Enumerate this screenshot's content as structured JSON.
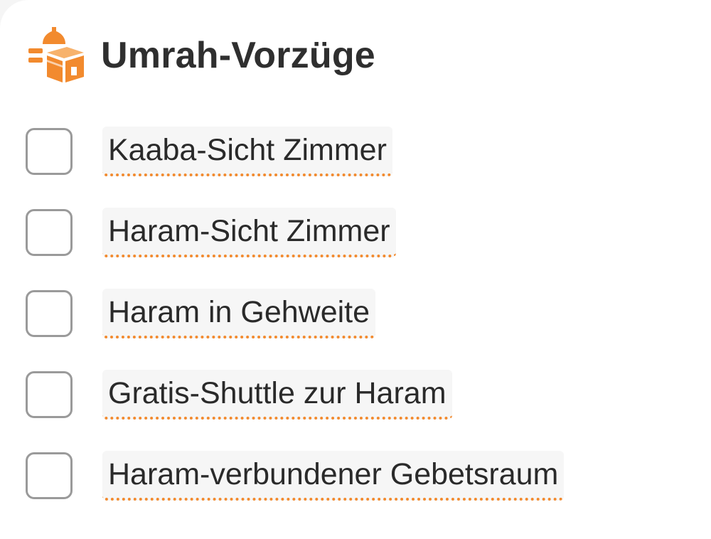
{
  "section": {
    "title": "Umrah-Vorzüge",
    "icon": "kaaba-icon",
    "accent_color": "#f28a2e"
  },
  "options": [
    {
      "label": "Kaaba-Sicht Zimmer",
      "checked": false
    },
    {
      "label": "Haram-Sicht Zimmer",
      "checked": false
    },
    {
      "label": "Haram in Gehweite",
      "checked": false
    },
    {
      "label": "Gratis-Shuttle zur Haram",
      "checked": false
    },
    {
      "label": "Haram-verbundener Gebetsraum",
      "checked": false
    }
  ]
}
